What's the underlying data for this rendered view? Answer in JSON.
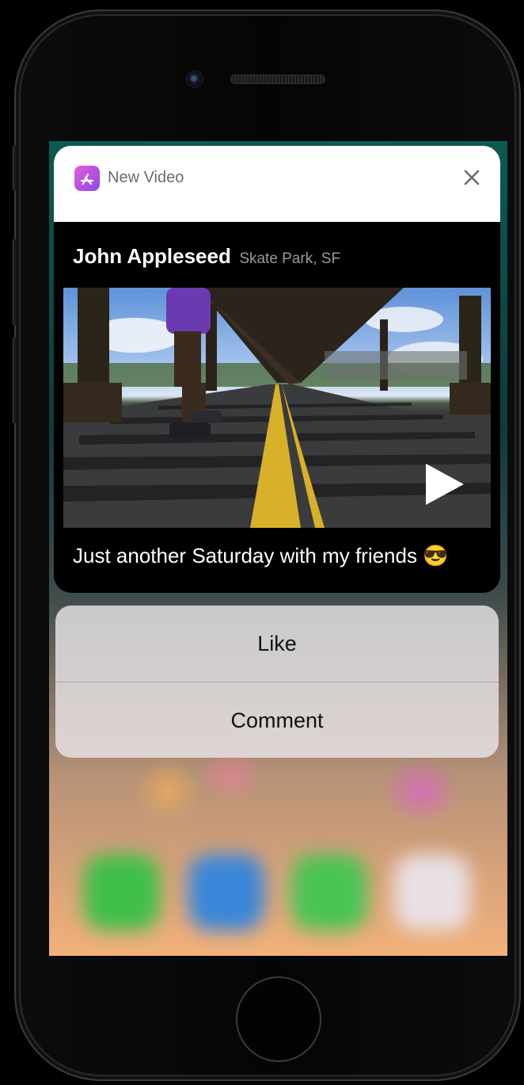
{
  "notification": {
    "app_name": "New Video",
    "author": "John Appleseed",
    "location": "Skate Park, SF",
    "caption": "Just another Saturday with my friends 😎"
  },
  "actions": [
    {
      "label": "Like"
    },
    {
      "label": "Comment"
    }
  ],
  "icons": {
    "app": "app-store-icon",
    "close": "close-icon",
    "play": "play-icon"
  },
  "colors": {
    "app_icon_gradient_start": "#e65bd9",
    "app_icon_gradient_end": "#8b4be6",
    "card_background": "#000000",
    "header_background": "#ffffff"
  }
}
